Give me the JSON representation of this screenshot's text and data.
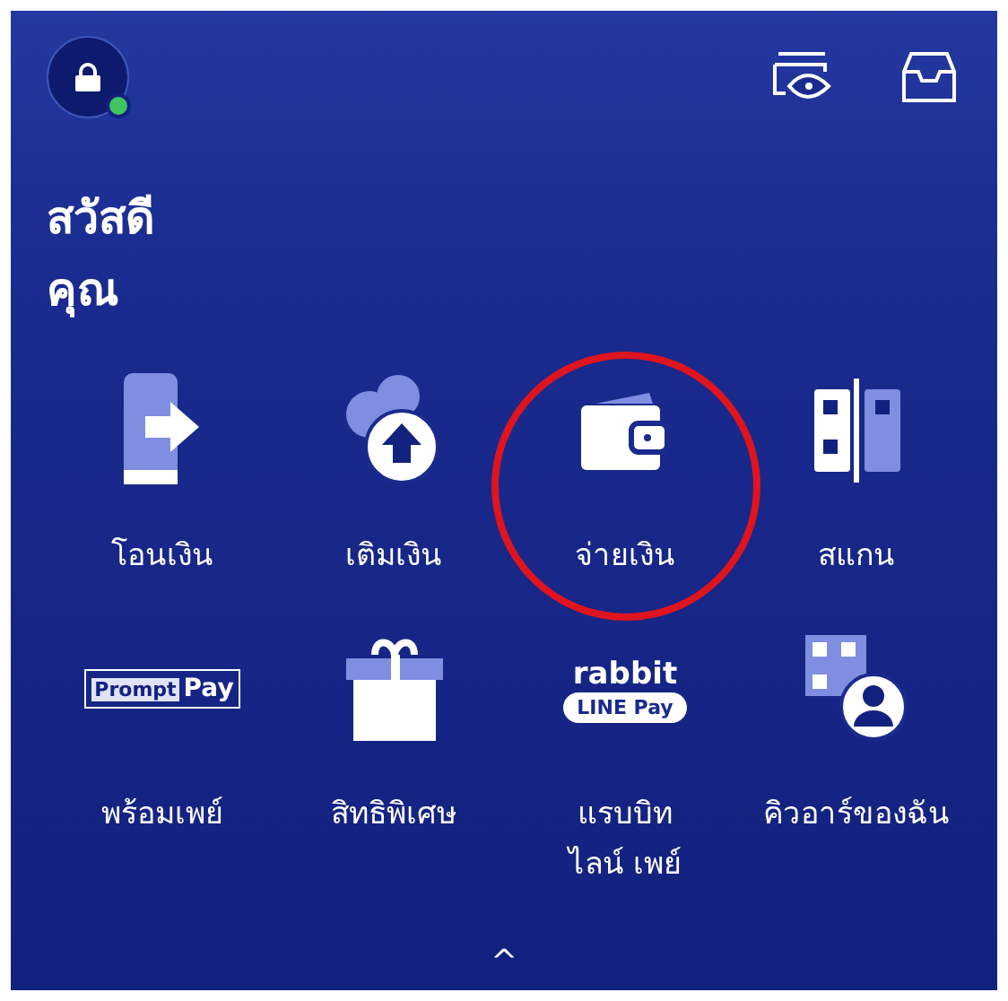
{
  "header": {
    "lock_online": true
  },
  "greeting": {
    "line_1": "สวัสดี",
    "line_2": "คุณ"
  },
  "menu": [
    {
      "kind": "transfer",
      "label": "โอนเงิน",
      "circled": false
    },
    {
      "kind": "topup",
      "label": "เติมเงิน",
      "circled": false
    },
    {
      "kind": "wallet",
      "label": "จ่ายเงิน",
      "circled": true
    },
    {
      "kind": "scan",
      "label": "สแกน",
      "circled": false
    },
    {
      "kind": "promptpay",
      "label": "พร้อมเพย์",
      "circled": false,
      "logo": [
        "Prompt",
        "Pay"
      ]
    },
    {
      "kind": "gift",
      "label": "สิทธิพิเศษ",
      "circled": false
    },
    {
      "kind": "rabbit",
      "label": "แรบบิท\nไลน์ เพย์",
      "circled": false,
      "logo": [
        "rabbit",
        "LINE Pay"
      ]
    },
    {
      "kind": "myqr",
      "label": "คิวอาร์ของฉัน",
      "circled": false
    }
  ],
  "footer": {
    "chevron": "^"
  }
}
